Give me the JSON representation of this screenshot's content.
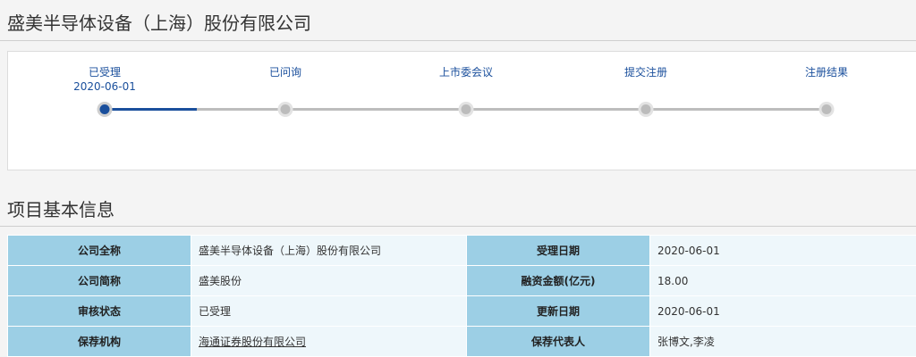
{
  "page_title": "盛美半导体设备（上海）股份有限公司",
  "timeline": {
    "steps": [
      {
        "label": "已受理",
        "date": "2020-06-01",
        "active": true
      },
      {
        "label": "已问询",
        "date": "",
        "active": false
      },
      {
        "label": "上市委会议",
        "date": "",
        "active": false
      },
      {
        "label": "提交注册",
        "date": "",
        "active": false
      },
      {
        "label": "注册结果",
        "date": "",
        "active": false
      }
    ],
    "progress_fraction": 0.125,
    "colors": {
      "active": "#1a4f9c",
      "inactive": "#bcbcbc"
    }
  },
  "section_title": "项目基本信息",
  "info": {
    "rows": [
      [
        {
          "key": "公司全称",
          "value": "盛美半导体设备（上海）股份有限公司"
        },
        {
          "key": "受理日期",
          "value": "2020-06-01"
        }
      ],
      [
        {
          "key": "公司简称",
          "value": "盛美股份"
        },
        {
          "key": "融资金额(亿元)",
          "value": "18.00"
        }
      ],
      [
        {
          "key": "审核状态",
          "value": "已受理"
        },
        {
          "key": "更新日期",
          "value": "2020-06-01"
        }
      ],
      [
        {
          "key": "保荐机构",
          "value": "海通证券股份有限公司"
        },
        {
          "key": "保荐代表人",
          "value": "张博文,李凌"
        }
      ]
    ],
    "colors": {
      "key_bg": "#9ccfe5",
      "value_bg": "#eef7fb"
    }
  }
}
